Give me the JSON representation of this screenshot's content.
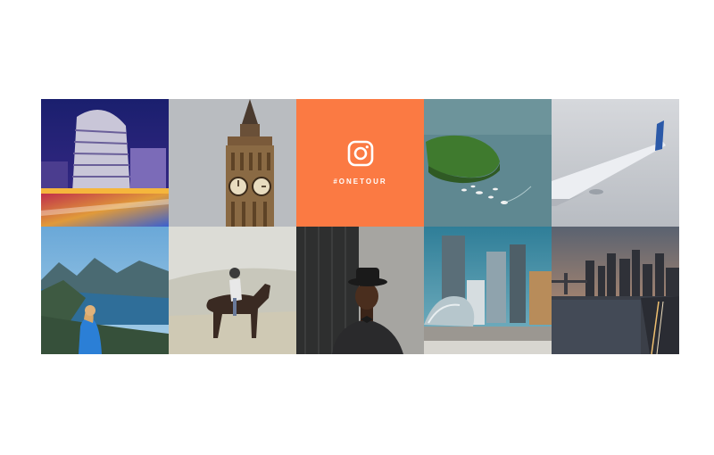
{
  "gallery": {
    "hashtag": "#ONETOUR",
    "accent_color": "#fb7a43",
    "icon": "instagram-icon",
    "tiles": [
      {
        "subject": "curved-building-night"
      },
      {
        "subject": "big-ben-clock-tower"
      },
      {
        "subject": "instagram-hashtag"
      },
      {
        "subject": "island-aerial-with-boats"
      },
      {
        "subject": "airplane-wing"
      },
      {
        "subject": "hiker-fjord-view"
      },
      {
        "subject": "boy-riding-horse"
      },
      {
        "subject": "man-in-black-hat"
      },
      {
        "subject": "chicago-bean-skyline"
      },
      {
        "subject": "city-river-sunset"
      }
    ]
  }
}
